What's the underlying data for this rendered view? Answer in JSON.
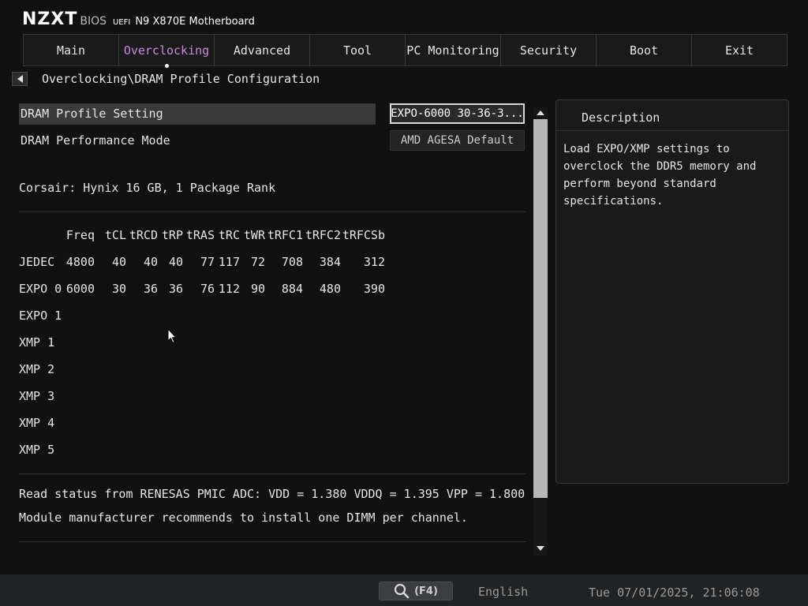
{
  "header": {
    "brand": "NZXT",
    "bios_label": "BIOS",
    "uefi_label": "UEFI",
    "model": "N9 X870E Motherboard"
  },
  "tabs": [
    {
      "label": "Main"
    },
    {
      "label": "Overclocking",
      "active": true
    },
    {
      "label": "Advanced"
    },
    {
      "label": "Tool"
    },
    {
      "label": "PC Monitoring"
    },
    {
      "label": "Security"
    },
    {
      "label": "Boot"
    },
    {
      "label": "Exit"
    }
  ],
  "breadcrumb": "Overclocking\\DRAM Profile Configuration",
  "settings": [
    {
      "label": "DRAM Profile Setting",
      "value": "EXPO-6000 30-36-3..."
    },
    {
      "label": "DRAM Performance Mode",
      "value": "AMD AGESA Default"
    }
  ],
  "memory_info": "Corsair: Hynix 16 GB, 1 Package Rank",
  "timing_table": {
    "headers": [
      "Freq",
      "tCL",
      "tRCD",
      "tRP",
      "tRAS",
      "tRC",
      "tWR",
      "tRFC1",
      "tRFC2",
      "tRFCSb"
    ],
    "rows": [
      {
        "name": "JEDEC",
        "values": [
          "4800",
          "40",
          "40",
          "40",
          "77",
          "117",
          "72",
          "708",
          "384",
          "312"
        ]
      },
      {
        "name": "EXPO 0",
        "values": [
          "6000",
          "30",
          "36",
          "36",
          "76",
          "112",
          "90",
          "884",
          "480",
          "390"
        ]
      },
      {
        "name": "EXPO 1",
        "values": []
      },
      {
        "name": "XMP 1",
        "values": []
      },
      {
        "name": "XMP 2",
        "values": []
      },
      {
        "name": "XMP 3",
        "values": []
      },
      {
        "name": "XMP 4",
        "values": []
      },
      {
        "name": "XMP 5",
        "values": []
      }
    ]
  },
  "status_lines": [
    "Read status from RENESAS PMIC ADC: VDD = 1.380 VDDQ = 1.395 VPP = 1.800",
    "Module manufacturer recommends to install one DIMM per channel."
  ],
  "description": {
    "title": "Description",
    "text": "Load EXPO/XMP settings to overclock the DDR5 memory and perform beyond standard specifications."
  },
  "footer": {
    "search_label": "(F4)",
    "language": "English",
    "datetime": "Tue 07/01/2025, 21:06:08"
  },
  "colors": {
    "background": "#111111",
    "active_tab": "#c98cdc",
    "highlight_row": "#3a3a3a",
    "scroll_thumb": "#b7b7b7",
    "footer": "#202224"
  }
}
